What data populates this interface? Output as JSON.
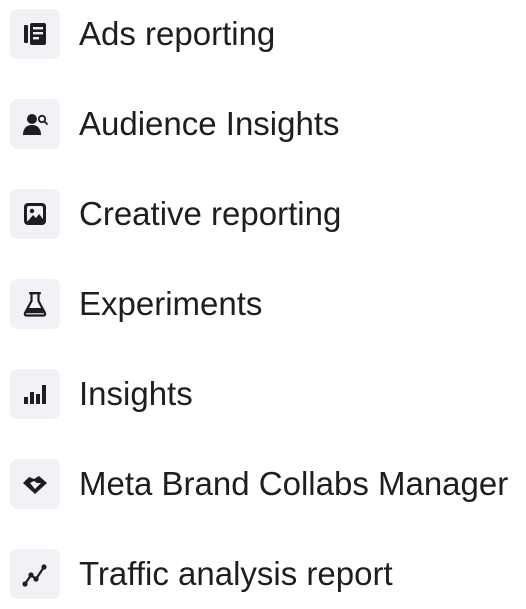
{
  "menu": {
    "items": [
      {
        "label": "Ads reporting",
        "icon": "ads-reporting-icon"
      },
      {
        "label": "Audience Insights",
        "icon": "audience-insights-icon"
      },
      {
        "label": "Creative reporting",
        "icon": "image-icon"
      },
      {
        "label": "Experiments",
        "icon": "flask-icon"
      },
      {
        "label": "Insights",
        "icon": "bar-chart-icon"
      },
      {
        "label": "Meta Brand Collabs Manager",
        "icon": "handshake-icon"
      },
      {
        "label": "Traffic analysis report",
        "icon": "trend-line-icon"
      }
    ]
  },
  "colors": {
    "icon_bg": "#f0f2f5",
    "icon_fg": "#1c1e21",
    "text": "#1c1e21"
  }
}
